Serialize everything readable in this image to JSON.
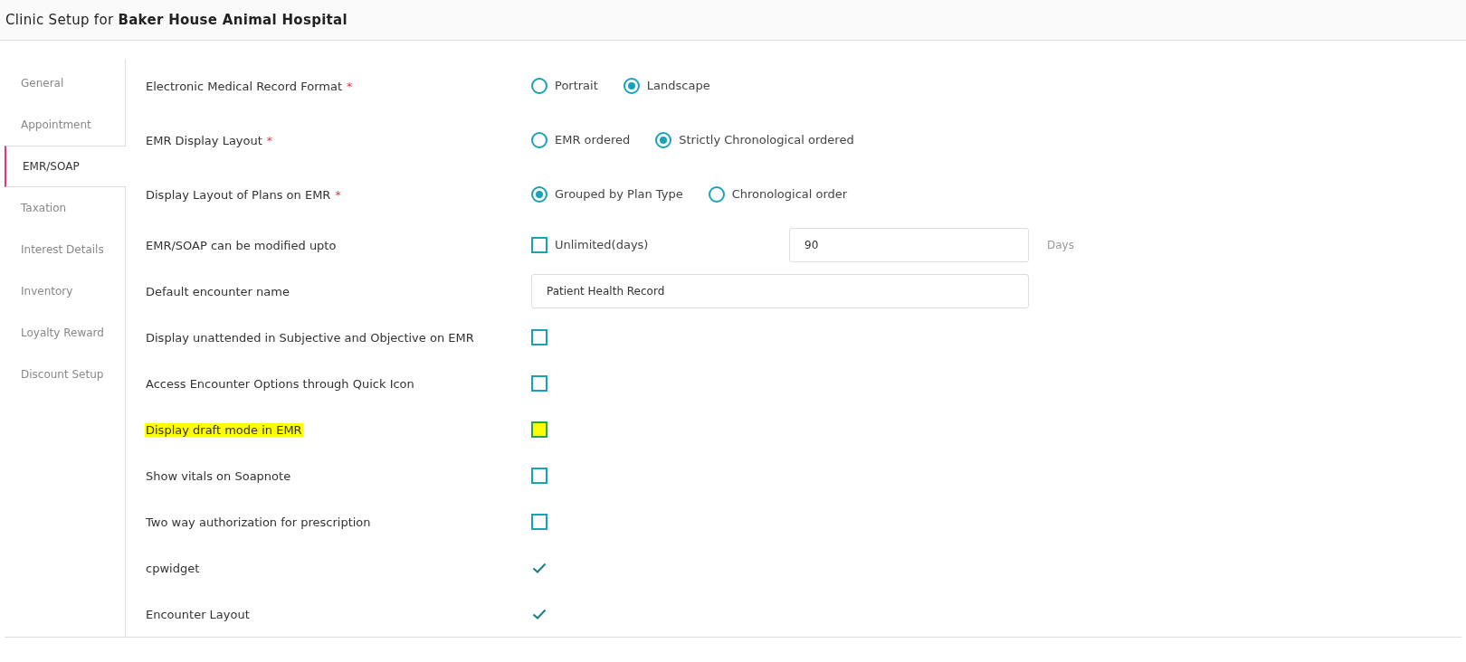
{
  "header": {
    "title": "Clinic Setup for **Baker House Animal Hospital**"
  },
  "sidebar": {
    "items": [
      {
        "label": "General",
        "selected": false
      },
      {
        "label": "Appointment",
        "selected": false
      },
      {
        "label": "EMR/SOAP",
        "selected": true
      },
      {
        "label": "Taxation",
        "selected": false
      },
      {
        "label": "Interest Details",
        "selected": false
      },
      {
        "label": "Inventory",
        "selected": false
      },
      {
        "label": "Loyalty Reward",
        "selected": false
      },
      {
        "label": "Discount Setup",
        "selected": false
      }
    ]
  },
  "settings": [
    {
      "kind": "radio",
      "label": "Electronic Medical Record Format",
      "required_mark": "*",
      "highlighted": false,
      "options": [
        {
          "label": "Portrait",
          "selected": false
        },
        {
          "label": "Landscape",
          "selected": true
        }
      ]
    },
    {
      "kind": "radio",
      "label": "EMR Display Layout",
      "required_mark": "*",
      "highlighted": false,
      "options": [
        {
          "label": "EMR ordered",
          "selected": false
        },
        {
          "label": "Strictly Chronological ordered",
          "selected": true
        }
      ]
    },
    {
      "kind": "radio",
      "label": "Display Layout of Plans on EMR",
      "required_mark": "*",
      "highlighted": false,
      "options": [
        {
          "label": "Grouped by Plan Type",
          "selected": true
        },
        {
          "label": "Chronological order",
          "selected": false
        }
      ]
    },
    {
      "kind": "limit",
      "label": "EMR/SOAP can be modified upto",
      "highlighted": false,
      "checkbox_label": "Unlimited(days)",
      "checked": false,
      "value": "90",
      "suffix": "Days"
    },
    {
      "kind": "text",
      "label": "Default encounter name",
      "highlighted": false,
      "value": "Patient Health Record"
    },
    {
      "kind": "checkbox",
      "label": "Display unattended in Subjective and Objective on EMR",
      "highlighted": false,
      "checked": false
    },
    {
      "kind": "checkbox",
      "label": "Access Encounter Options through Quick Icon",
      "highlighted": false,
      "checked": false
    },
    {
      "kind": "checkbox",
      "label": "Display draft mode in EMR",
      "highlighted": true,
      "checked": false
    },
    {
      "kind": "checkbox",
      "label": "Show vitals on Soapnote",
      "highlighted": false,
      "checked": false
    },
    {
      "kind": "checkbox",
      "label": "Two way authorization for prescription",
      "highlighted": false,
      "checked": false
    },
    {
      "kind": "checkbox",
      "label": "cpwidget",
      "highlighted": false,
      "checked": true
    },
    {
      "kind": "checkbox",
      "label": "Encounter Layout",
      "highlighted": false,
      "checked": true
    }
  ]
}
